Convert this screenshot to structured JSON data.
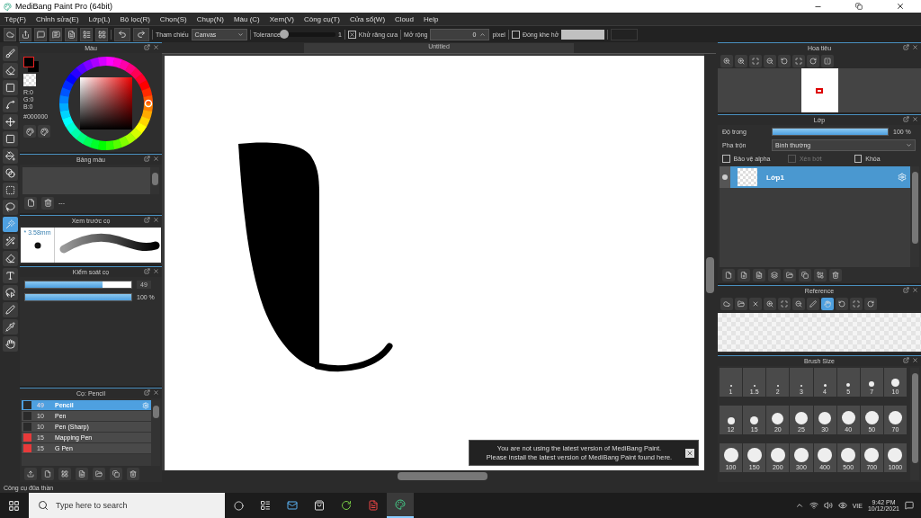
{
  "window": {
    "title": "MediBang Paint Pro (64bit)"
  },
  "menu": [
    "Tệp(F)",
    "Chỉnh sửa(E)",
    "Lớp(L)",
    "Bộ lọc(R)",
    "Chọn(S)",
    "Chụp(N)",
    "Màu (C)",
    "Xem(V)",
    "Công cụ(T)",
    "Cửa sổ(W)",
    "Cloud",
    "Help"
  ],
  "toolbar": {
    "reference_label": "Tham chiếu",
    "reference_value": "Canvas",
    "tolerance_label": "Tolerance",
    "tolerance": {
      "level": 0.02,
      "reading": "1"
    },
    "antialias": {
      "label": "Khử răng cưa",
      "checked": true
    },
    "expand_label": "Mở rộng",
    "expand_value": "0",
    "expand_unit": "pixel",
    "close_gap": {
      "label": "Đóng khe hở",
      "checked": false
    }
  },
  "tools": [
    {
      "selected": false
    },
    {
      "selected": false
    },
    {
      "selected": false
    },
    {
      "selected": false
    },
    {
      "selected": false
    },
    {
      "selected": false
    },
    {
      "selected": false
    },
    {
      "selected": false
    },
    {
      "selected": false
    },
    {
      "selected": false
    },
    {
      "selected": true
    },
    {
      "selected": false
    },
    {
      "selected": false
    },
    {
      "selected": false
    },
    {
      "selected": false
    },
    {
      "selected": false
    },
    {
      "selected": false
    },
    {
      "selected": false
    }
  ],
  "color_panel": {
    "title": "Màu",
    "r": "R:0",
    "g": "G:0",
    "b": "B:0",
    "hex": "#000000"
  },
  "palette_panel": {
    "title": "Bảng màu",
    "name": "---"
  },
  "brush_preview": {
    "title": "Xem trước cọ",
    "size": "* 3.58mm"
  },
  "brush_control": {
    "title": "Kiểm soát cọ",
    "size": {
      "level": 0.73,
      "reading": "49"
    },
    "opacity": {
      "level": 1,
      "reading": "100 %"
    }
  },
  "brush_list": {
    "title": "Cọ: Pencil",
    "items": [
      {
        "size": "49",
        "name": "Pencil",
        "color": "#2a2a2a",
        "selected": true
      },
      {
        "size": "10",
        "name": "Pen",
        "color": "#2a2a2a",
        "selected": false
      },
      {
        "size": "10",
        "name": "Pen (Sharp)",
        "color": "#2a2a2a",
        "selected": false
      },
      {
        "size": "15",
        "name": "Mapping Pen",
        "color": "#e83a3a",
        "selected": false
      },
      {
        "size": "15",
        "name": "G Pen",
        "color": "#e83a3a",
        "selected": false
      }
    ]
  },
  "canvas": {
    "tab": "Untitled"
  },
  "notice": {
    "lines": [
      "You are not using the latest version of MediBang Paint.",
      "Please install the latest version of MediBang Paint found here."
    ]
  },
  "navigator": {
    "title": "Hoa tiêu"
  },
  "layer_panel": {
    "title": "Lớp",
    "opacity_label": "Độ trong",
    "opacity": {
      "level": 1,
      "reading": "100 %"
    },
    "blend_label": "Pha trộn",
    "blend_value": "Bình thường",
    "options": [
      {
        "label": "Bảo vệ alpha",
        "checked": false,
        "disabled": false
      },
      {
        "label": "Xén bớt",
        "checked": false,
        "disabled": true
      },
      {
        "label": "Khóa",
        "checked": false,
        "disabled": false
      }
    ],
    "layers": [
      {
        "name": "Lớp1",
        "selected": true,
        "visible": true
      }
    ]
  },
  "reference_panel": {
    "title": "Reference",
    "tools": [
      {
        "selected": false
      },
      {
        "selected": false
      },
      {
        "selected": false
      },
      {
        "selected": false
      },
      {
        "selected": false
      },
      {
        "selected": false
      },
      {
        "selected": false
      },
      {
        "selected": true
      },
      {
        "selected": false
      },
      {
        "selected": false
      },
      {
        "selected": false
      }
    ]
  },
  "brush_size_panel": {
    "title": "Brush Size",
    "sizes": [
      "1",
      "1.5",
      "2",
      "3",
      "4",
      "5",
      "7",
      "10",
      "12",
      "15",
      "20",
      "25",
      "30",
      "40",
      "50",
      "70",
      "100",
      "150",
      "200",
      "300",
      "400",
      "500",
      "700",
      "1000"
    ]
  },
  "status_bar": "Công cụ đũa thần",
  "taskbar": {
    "search_placeholder": "Type here to search",
    "language": "VIE",
    "time": "9:42 PM",
    "date": "10/12/2021"
  }
}
